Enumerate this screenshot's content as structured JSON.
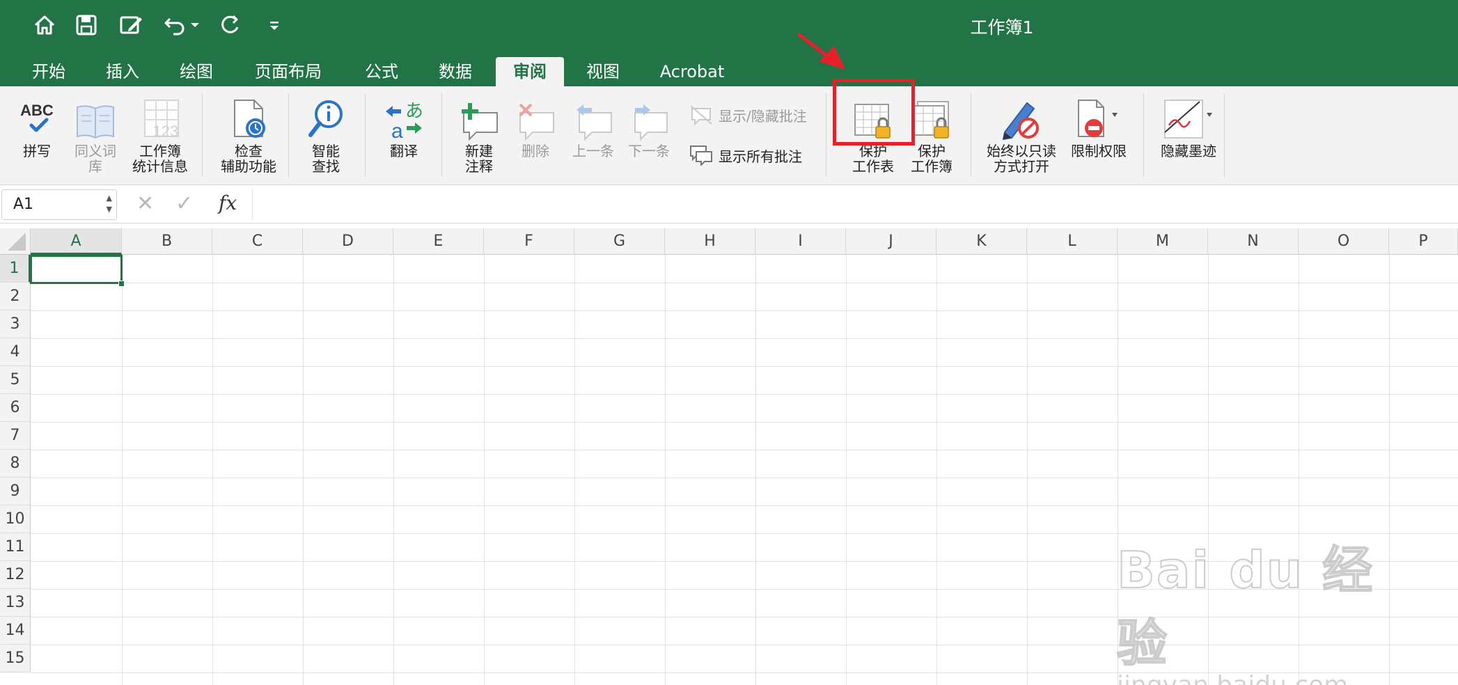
{
  "window": {
    "title": "工作簿1"
  },
  "quick_access": [
    "home-icon",
    "save-icon",
    "edit-icon",
    "undo-icon",
    "redo-icon",
    "customize-icon"
  ],
  "tabs": [
    {
      "label": "开始"
    },
    {
      "label": "插入"
    },
    {
      "label": "绘图"
    },
    {
      "label": "页面布局"
    },
    {
      "label": "公式"
    },
    {
      "label": "数据"
    },
    {
      "label": "审阅",
      "active": true
    },
    {
      "label": "视图"
    },
    {
      "label": "Acrobat"
    }
  ],
  "ribbon": {
    "spelling": {
      "icon_text": "ABC",
      "label": "拼写"
    },
    "thesaurus": {
      "label": "同义词\n库"
    },
    "workbook_stats": {
      "icon_text": "123",
      "label": "工作簿\n统计信息"
    },
    "accessibility": {
      "label": "检查\n辅助功能"
    },
    "smart_lookup": {
      "label": "智能\n查找"
    },
    "translate": {
      "icon_text_a": "a",
      "icon_text_b": "あ",
      "label": "翻译"
    },
    "new_comment": {
      "label": "新建\n注释"
    },
    "delete": {
      "label": "删除"
    },
    "previous": {
      "label": "上一条"
    },
    "next": {
      "label": "下一条"
    },
    "show_hide_comments": {
      "label": "显示/隐藏批注"
    },
    "show_all_comments": {
      "label": "显示所有批注"
    },
    "protect_sheet": {
      "label": "保护\n工作表"
    },
    "protect_workbook": {
      "label": "保护\n工作簿"
    },
    "always_open_readonly": {
      "label": "始终以只读\n方式打开"
    },
    "restrict_permission": {
      "label": "限制权限"
    },
    "hide_ink": {
      "label": "隐藏墨迹"
    }
  },
  "formula_bar": {
    "name_box": "A1",
    "fx_label": "fx",
    "value": ""
  },
  "columns": [
    "A",
    "B",
    "C",
    "D",
    "E",
    "F",
    "G",
    "H",
    "I",
    "J",
    "K",
    "L",
    "M",
    "N",
    "O",
    "P"
  ],
  "rows": [
    "1",
    "2",
    "3",
    "4",
    "5",
    "6",
    "7",
    "8",
    "9",
    "10",
    "11",
    "12",
    "13",
    "14",
    "15"
  ],
  "selected_cell": "A1",
  "watermark": {
    "main": "Bai du 经验",
    "sub": "jingyan.baidu.com"
  },
  "colors": {
    "accent": "#227447",
    "highlight": "#e8202a",
    "ribbon_bg": "#f3f3f3"
  }
}
